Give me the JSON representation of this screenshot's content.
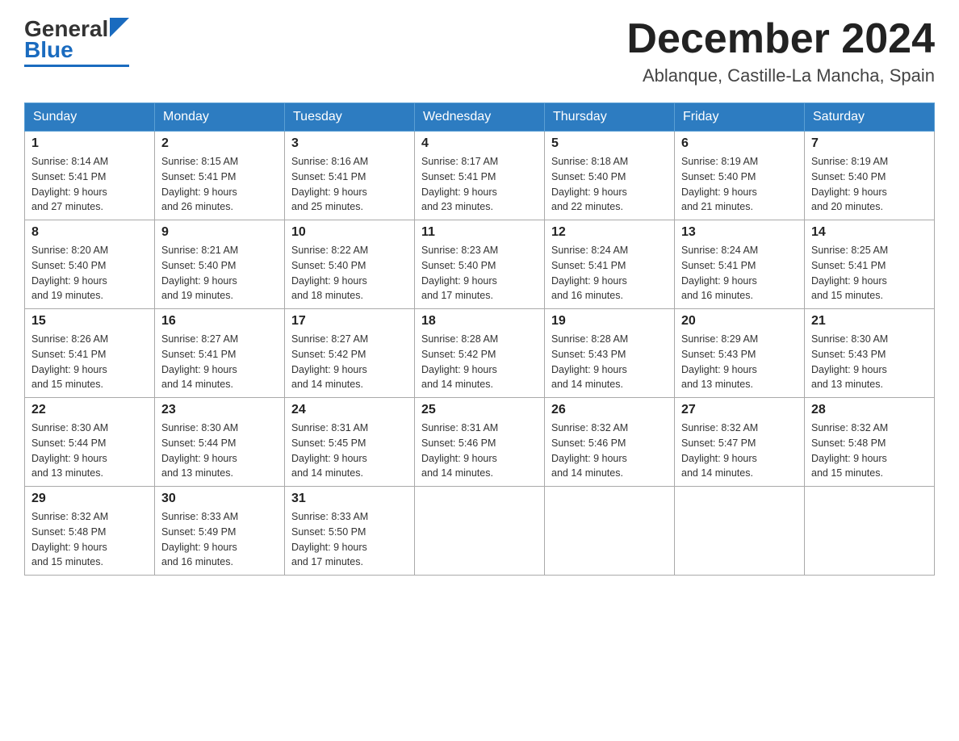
{
  "header": {
    "logo_general": "General",
    "logo_blue": "Blue",
    "month_title": "December 2024",
    "location": "Ablanque, Castille-La Mancha, Spain"
  },
  "weekdays": [
    "Sunday",
    "Monday",
    "Tuesday",
    "Wednesday",
    "Thursday",
    "Friday",
    "Saturday"
  ],
  "weeks": [
    [
      {
        "day": "1",
        "sunrise": "8:14 AM",
        "sunset": "5:41 PM",
        "daylight": "9 hours and 27 minutes."
      },
      {
        "day": "2",
        "sunrise": "8:15 AM",
        "sunset": "5:41 PM",
        "daylight": "9 hours and 26 minutes."
      },
      {
        "day": "3",
        "sunrise": "8:16 AM",
        "sunset": "5:41 PM",
        "daylight": "9 hours and 25 minutes."
      },
      {
        "day": "4",
        "sunrise": "8:17 AM",
        "sunset": "5:41 PM",
        "daylight": "9 hours and 23 minutes."
      },
      {
        "day": "5",
        "sunrise": "8:18 AM",
        "sunset": "5:40 PM",
        "daylight": "9 hours and 22 minutes."
      },
      {
        "day": "6",
        "sunrise": "8:19 AM",
        "sunset": "5:40 PM",
        "daylight": "9 hours and 21 minutes."
      },
      {
        "day": "7",
        "sunrise": "8:19 AM",
        "sunset": "5:40 PM",
        "daylight": "9 hours and 20 minutes."
      }
    ],
    [
      {
        "day": "8",
        "sunrise": "8:20 AM",
        "sunset": "5:40 PM",
        "daylight": "9 hours and 19 minutes."
      },
      {
        "day": "9",
        "sunrise": "8:21 AM",
        "sunset": "5:40 PM",
        "daylight": "9 hours and 19 minutes."
      },
      {
        "day": "10",
        "sunrise": "8:22 AM",
        "sunset": "5:40 PM",
        "daylight": "9 hours and 18 minutes."
      },
      {
        "day": "11",
        "sunrise": "8:23 AM",
        "sunset": "5:40 PM",
        "daylight": "9 hours and 17 minutes."
      },
      {
        "day": "12",
        "sunrise": "8:24 AM",
        "sunset": "5:41 PM",
        "daylight": "9 hours and 16 minutes."
      },
      {
        "day": "13",
        "sunrise": "8:24 AM",
        "sunset": "5:41 PM",
        "daylight": "9 hours and 16 minutes."
      },
      {
        "day": "14",
        "sunrise": "8:25 AM",
        "sunset": "5:41 PM",
        "daylight": "9 hours and 15 minutes."
      }
    ],
    [
      {
        "day": "15",
        "sunrise": "8:26 AM",
        "sunset": "5:41 PM",
        "daylight": "9 hours and 15 minutes."
      },
      {
        "day": "16",
        "sunrise": "8:27 AM",
        "sunset": "5:41 PM",
        "daylight": "9 hours and 14 minutes."
      },
      {
        "day": "17",
        "sunrise": "8:27 AM",
        "sunset": "5:42 PM",
        "daylight": "9 hours and 14 minutes."
      },
      {
        "day": "18",
        "sunrise": "8:28 AM",
        "sunset": "5:42 PM",
        "daylight": "9 hours and 14 minutes."
      },
      {
        "day": "19",
        "sunrise": "8:28 AM",
        "sunset": "5:43 PM",
        "daylight": "9 hours and 14 minutes."
      },
      {
        "day": "20",
        "sunrise": "8:29 AM",
        "sunset": "5:43 PM",
        "daylight": "9 hours and 13 minutes."
      },
      {
        "day": "21",
        "sunrise": "8:30 AM",
        "sunset": "5:43 PM",
        "daylight": "9 hours and 13 minutes."
      }
    ],
    [
      {
        "day": "22",
        "sunrise": "8:30 AM",
        "sunset": "5:44 PM",
        "daylight": "9 hours and 13 minutes."
      },
      {
        "day": "23",
        "sunrise": "8:30 AM",
        "sunset": "5:44 PM",
        "daylight": "9 hours and 13 minutes."
      },
      {
        "day": "24",
        "sunrise": "8:31 AM",
        "sunset": "5:45 PM",
        "daylight": "9 hours and 14 minutes."
      },
      {
        "day": "25",
        "sunrise": "8:31 AM",
        "sunset": "5:46 PM",
        "daylight": "9 hours and 14 minutes."
      },
      {
        "day": "26",
        "sunrise": "8:32 AM",
        "sunset": "5:46 PM",
        "daylight": "9 hours and 14 minutes."
      },
      {
        "day": "27",
        "sunrise": "8:32 AM",
        "sunset": "5:47 PM",
        "daylight": "9 hours and 14 minutes."
      },
      {
        "day": "28",
        "sunrise": "8:32 AM",
        "sunset": "5:48 PM",
        "daylight": "9 hours and 15 minutes."
      }
    ],
    [
      {
        "day": "29",
        "sunrise": "8:32 AM",
        "sunset": "5:48 PM",
        "daylight": "9 hours and 15 minutes."
      },
      {
        "day": "30",
        "sunrise": "8:33 AM",
        "sunset": "5:49 PM",
        "daylight": "9 hours and 16 minutes."
      },
      {
        "day": "31",
        "sunrise": "8:33 AM",
        "sunset": "5:50 PM",
        "daylight": "9 hours and 17 minutes."
      },
      null,
      null,
      null,
      null
    ]
  ],
  "labels": {
    "sunrise": "Sunrise:",
    "sunset": "Sunset:",
    "daylight": "Daylight:"
  }
}
